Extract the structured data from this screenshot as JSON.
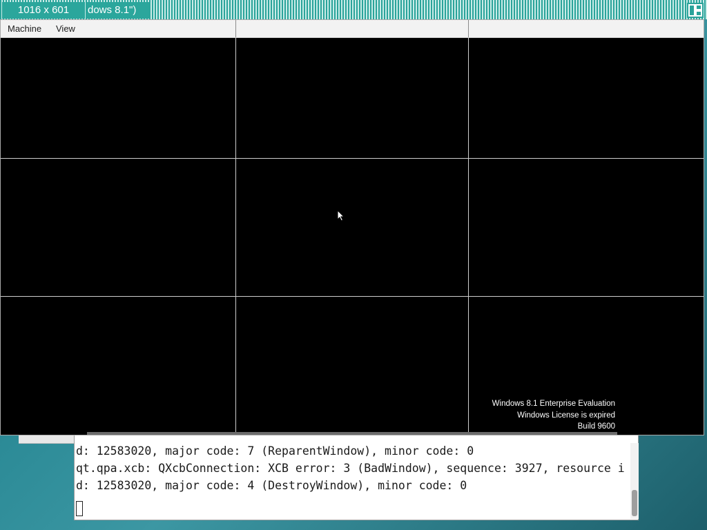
{
  "titlebar": {
    "resolution": "1016 x 601",
    "title_fragment": "dows 8.1\")"
  },
  "menu": {
    "items": [
      "Machine",
      "View"
    ]
  },
  "guest": {
    "watermark": {
      "line1": "Windows 8.1 Enterprise Evaluation",
      "line2": "Windows License is expired",
      "line3": "Build 9600"
    }
  },
  "terminal": {
    "lines": [
      "d: 12583020, major code: 7 (ReparentWindow), minor code: 0",
      "qt.qpa.xcb: QXcbConnection: XCB error: 3 (BadWindow), sequence: 3927, resource i",
      "d: 12583020, major code: 4 (DestroyWindow), minor code: 0"
    ]
  },
  "icons": {
    "resize": "resize-screen-icon",
    "start": "windows-start-icon",
    "pointer": "mouse-pointer-icon"
  }
}
